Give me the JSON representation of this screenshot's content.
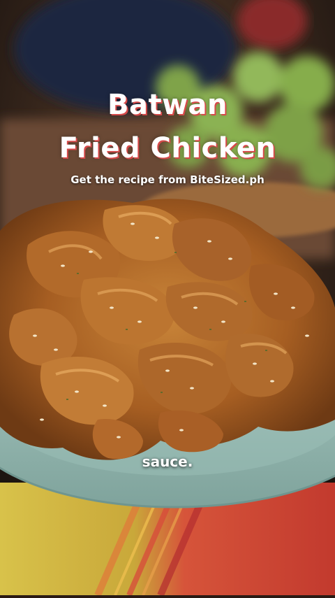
{
  "overlay": {
    "title_line1": "Batwan",
    "title_line2": "Fried Chicken",
    "subtitle": "Get the recipe from BiteSized.ph",
    "caption": "sauce."
  },
  "colors": {
    "title_shadow": "#d64a4a",
    "plate": "#8fb4ad",
    "chicken": "#b8712e",
    "background_green": "#7fa34a"
  }
}
